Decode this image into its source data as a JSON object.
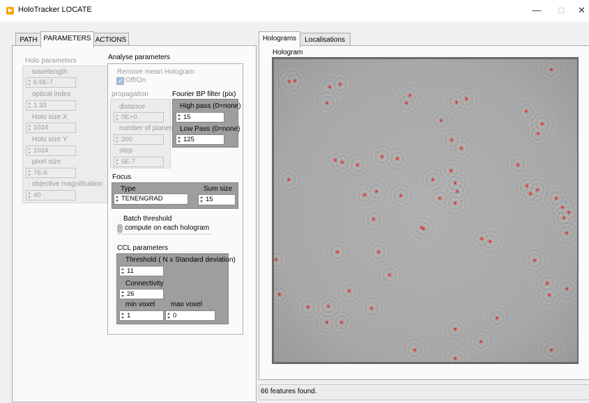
{
  "window": {
    "title": "HoloTracker LOCATE",
    "minimize_glyph": "—",
    "maximize_glyph": "□",
    "close_glyph": "✕"
  },
  "left_tabs": [
    {
      "label": "PATH",
      "active": false
    },
    {
      "label": "PARAMETERS",
      "active": true
    },
    {
      "label": "ACTIONS",
      "active": false
    }
  ],
  "holo_params": {
    "title": "Holo parameters",
    "wavelength_label": "wavelength",
    "wavelength": "6.6E-7",
    "optical_index_label": "optical index",
    "optical_index": "1.33",
    "size_x_label": "Holo size X",
    "size_x": "1024",
    "size_y_label": "Holo size Y",
    "size_y": "1024",
    "pixel_size_label": "pixel size",
    "pixel_size": "7E-6",
    "objective_label": "objective magnification",
    "objective": "40"
  },
  "analyse": {
    "title": "Analyse parameters",
    "remove_mean_label": "Remove mean Hologram",
    "remove_mean_toggle": "Off/On",
    "remove_mean_checked": true,
    "propagation_title": "propagation",
    "distance_label": "distance",
    "distance": "0E+0",
    "planes_label": "number of planes",
    "planes": "200",
    "step_label": "step",
    "step": "5E-7",
    "fourier_title": "Fourier BP filter (pix)",
    "high_pass_label": "High pass (0=none)",
    "high_pass": "15",
    "low_pass_label": "Low Pass (0=none)",
    "low_pass": "125",
    "focus_title": "Focus",
    "type_label": "Type",
    "type_value": "TENENGRAD",
    "sum_size_label": "Sum size",
    "sum_size": "15",
    "batch_label": "Batch threshold",
    "batch_value": "compute on each hologram",
    "ccl_title": "CCL parameters",
    "threshold_label": "Threshold ( N x Standard deviation)",
    "threshold": "11",
    "connectivity_label": "Connectivity",
    "connectivity": "26",
    "min_voxel_label": "min voxel",
    "min_voxel": "1",
    "max_voxel_label": "max voxel",
    "max_voxel": "0"
  },
  "right_tabs": [
    {
      "label": "Holograms",
      "active": true
    },
    {
      "label": "Localisations",
      "active": false
    }
  ],
  "hologram": {
    "label": "Hologram",
    "background_color": "#a9a9a9",
    "marker_color": "#ff1a1a"
  },
  "status": "66 features found."
}
